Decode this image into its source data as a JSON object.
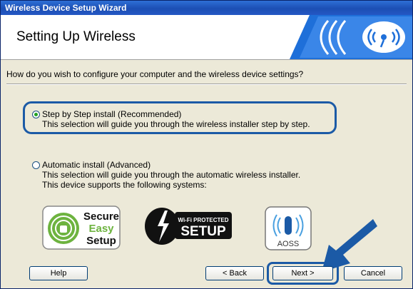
{
  "window": {
    "title": "Wireless Device Setup Wizard"
  },
  "header": {
    "title": "Setting Up Wireless",
    "logo": "wireless-waves-logo"
  },
  "question": "How do you wish to configure your computer and the wireless device settings?",
  "options": [
    {
      "label": "Step by Step install (Recommended)",
      "desc": [
        "This selection will guide you through the wireless installer step by step."
      ],
      "selected": true
    },
    {
      "label": "Automatic install (Advanced)",
      "desc": [
        "This selection will guide you through the automatic wireless installer.",
        "This device supports the following systems:"
      ],
      "selected": false
    }
  ],
  "logos": {
    "ses": {
      "line1": "Secure",
      "line2": "Easy",
      "line3": "Setup"
    },
    "wps": {
      "line1": "Wi-Fi PROTECTED",
      "line2": "SETUP"
    },
    "aoss": {
      "text": "AOSS"
    }
  },
  "buttons": {
    "help": "Help",
    "back": "< Back",
    "next": "Next >",
    "cancel": "Cancel"
  },
  "colors": {
    "title_bar": "#1c4fb4",
    "accent_blue": "#1b5aa6",
    "header_logo": "#1e6fd9",
    "ses_green": "#6db33f",
    "wps_black": "#111111"
  }
}
